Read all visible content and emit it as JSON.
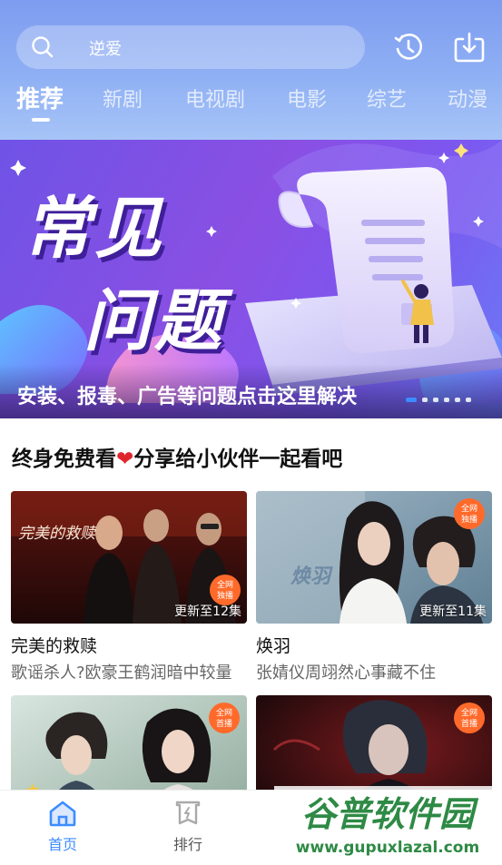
{
  "colors": {
    "accent": "#3d8cff",
    "header_top": "#7d9cf0",
    "banner_bg": "#7c57f0",
    "badge": "#ff6a2b",
    "heart": "#e0262d"
  },
  "search": {
    "icon": "search-icon",
    "text": "逆爱"
  },
  "top_actions": [
    {
      "icon": "history-icon"
    },
    {
      "icon": "download-icon"
    }
  ],
  "tabs": [
    {
      "label": "推荐",
      "active": true
    },
    {
      "label": "新剧"
    },
    {
      "label": "电视剧"
    },
    {
      "label": "电影"
    },
    {
      "label": "综艺"
    },
    {
      "label": "动漫"
    }
  ],
  "banner": {
    "title_line1": "常见",
    "title_line2": "问题",
    "caption": "安装、报毒、广告等问题点击这里解决",
    "slide_count": 6,
    "active_slide": 1
  },
  "section": {
    "title_before": "终身免费看",
    "heart": "❤",
    "title_after": "分享给小伙伴一起看吧"
  },
  "cards": [
    {
      "title": "完美的救赎",
      "desc": "歌谣杀人?欧豪王鹤润暗中较量",
      "update": "更新至12集",
      "poster_text": "完美的救赎",
      "badge_line1": "全网",
      "badge_line2": "独播"
    },
    {
      "title": "焕羽",
      "desc": "张婧仪周翊然心事藏不住",
      "update": "更新至11集",
      "poster_text": "焕羽",
      "badge_line1": "全网",
      "badge_line2": "独播"
    },
    {
      "badge_line1": "全网",
      "badge_line2": "首播"
    },
    {
      "badge_line1": "全网",
      "badge_line2": "首播"
    }
  ],
  "bottom_nav": [
    {
      "label": "首页",
      "icon": "home-icon",
      "active": true
    },
    {
      "label": "排行",
      "icon": "ranking-icon"
    }
  ],
  "watermark": {
    "text_cn": "谷普软件园",
    "text_url": "www.gupuxlazal.com"
  }
}
